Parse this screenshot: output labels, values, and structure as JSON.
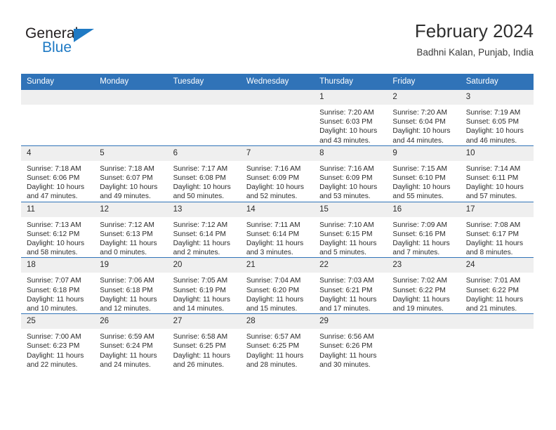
{
  "brand": {
    "name_part1": "General",
    "name_part2": "Blue",
    "accent_color": "#1f7ac4"
  },
  "header": {
    "title": "February 2024",
    "subtitle": "Badhni Kalan, Punjab, India"
  },
  "theme": {
    "header_bar_color": "#3073b8",
    "daynum_band_color": "#efefef",
    "text_color": "#2b2b2b"
  },
  "weekday_headers": [
    "Sunday",
    "Monday",
    "Tuesday",
    "Wednesday",
    "Thursday",
    "Friday",
    "Saturday"
  ],
  "weeks": [
    [
      {
        "day": "",
        "empty": true
      },
      {
        "day": "",
        "empty": true
      },
      {
        "day": "",
        "empty": true
      },
      {
        "day": "",
        "empty": true
      },
      {
        "day": "1",
        "sunrise": "Sunrise: 7:20 AM",
        "sunset": "Sunset: 6:03 PM",
        "daylight_line1": "Daylight: 10 hours",
        "daylight_line2": "and 43 minutes."
      },
      {
        "day": "2",
        "sunrise": "Sunrise: 7:20 AM",
        "sunset": "Sunset: 6:04 PM",
        "daylight_line1": "Daylight: 10 hours",
        "daylight_line2": "and 44 minutes."
      },
      {
        "day": "3",
        "sunrise": "Sunrise: 7:19 AM",
        "sunset": "Sunset: 6:05 PM",
        "daylight_line1": "Daylight: 10 hours",
        "daylight_line2": "and 46 minutes."
      }
    ],
    [
      {
        "day": "4",
        "sunrise": "Sunrise: 7:18 AM",
        "sunset": "Sunset: 6:06 PM",
        "daylight_line1": "Daylight: 10 hours",
        "daylight_line2": "and 47 minutes."
      },
      {
        "day": "5",
        "sunrise": "Sunrise: 7:18 AM",
        "sunset": "Sunset: 6:07 PM",
        "daylight_line1": "Daylight: 10 hours",
        "daylight_line2": "and 49 minutes."
      },
      {
        "day": "6",
        "sunrise": "Sunrise: 7:17 AM",
        "sunset": "Sunset: 6:08 PM",
        "daylight_line1": "Daylight: 10 hours",
        "daylight_line2": "and 50 minutes."
      },
      {
        "day": "7",
        "sunrise": "Sunrise: 7:16 AM",
        "sunset": "Sunset: 6:09 PM",
        "daylight_line1": "Daylight: 10 hours",
        "daylight_line2": "and 52 minutes."
      },
      {
        "day": "8",
        "sunrise": "Sunrise: 7:16 AM",
        "sunset": "Sunset: 6:09 PM",
        "daylight_line1": "Daylight: 10 hours",
        "daylight_line2": "and 53 minutes."
      },
      {
        "day": "9",
        "sunrise": "Sunrise: 7:15 AM",
        "sunset": "Sunset: 6:10 PM",
        "daylight_line1": "Daylight: 10 hours",
        "daylight_line2": "and 55 minutes."
      },
      {
        "day": "10",
        "sunrise": "Sunrise: 7:14 AM",
        "sunset": "Sunset: 6:11 PM",
        "daylight_line1": "Daylight: 10 hours",
        "daylight_line2": "and 57 minutes."
      }
    ],
    [
      {
        "day": "11",
        "sunrise": "Sunrise: 7:13 AM",
        "sunset": "Sunset: 6:12 PM",
        "daylight_line1": "Daylight: 10 hours",
        "daylight_line2": "and 58 minutes."
      },
      {
        "day": "12",
        "sunrise": "Sunrise: 7:12 AM",
        "sunset": "Sunset: 6:13 PM",
        "daylight_line1": "Daylight: 11 hours",
        "daylight_line2": "and 0 minutes."
      },
      {
        "day": "13",
        "sunrise": "Sunrise: 7:12 AM",
        "sunset": "Sunset: 6:14 PM",
        "daylight_line1": "Daylight: 11 hours",
        "daylight_line2": "and 2 minutes."
      },
      {
        "day": "14",
        "sunrise": "Sunrise: 7:11 AM",
        "sunset": "Sunset: 6:14 PM",
        "daylight_line1": "Daylight: 11 hours",
        "daylight_line2": "and 3 minutes."
      },
      {
        "day": "15",
        "sunrise": "Sunrise: 7:10 AM",
        "sunset": "Sunset: 6:15 PM",
        "daylight_line1": "Daylight: 11 hours",
        "daylight_line2": "and 5 minutes."
      },
      {
        "day": "16",
        "sunrise": "Sunrise: 7:09 AM",
        "sunset": "Sunset: 6:16 PM",
        "daylight_line1": "Daylight: 11 hours",
        "daylight_line2": "and 7 minutes."
      },
      {
        "day": "17",
        "sunrise": "Sunrise: 7:08 AM",
        "sunset": "Sunset: 6:17 PM",
        "daylight_line1": "Daylight: 11 hours",
        "daylight_line2": "and 8 minutes."
      }
    ],
    [
      {
        "day": "18",
        "sunrise": "Sunrise: 7:07 AM",
        "sunset": "Sunset: 6:18 PM",
        "daylight_line1": "Daylight: 11 hours",
        "daylight_line2": "and 10 minutes."
      },
      {
        "day": "19",
        "sunrise": "Sunrise: 7:06 AM",
        "sunset": "Sunset: 6:18 PM",
        "daylight_line1": "Daylight: 11 hours",
        "daylight_line2": "and 12 minutes."
      },
      {
        "day": "20",
        "sunrise": "Sunrise: 7:05 AM",
        "sunset": "Sunset: 6:19 PM",
        "daylight_line1": "Daylight: 11 hours",
        "daylight_line2": "and 14 minutes."
      },
      {
        "day": "21",
        "sunrise": "Sunrise: 7:04 AM",
        "sunset": "Sunset: 6:20 PM",
        "daylight_line1": "Daylight: 11 hours",
        "daylight_line2": "and 15 minutes."
      },
      {
        "day": "22",
        "sunrise": "Sunrise: 7:03 AM",
        "sunset": "Sunset: 6:21 PM",
        "daylight_line1": "Daylight: 11 hours",
        "daylight_line2": "and 17 minutes."
      },
      {
        "day": "23",
        "sunrise": "Sunrise: 7:02 AM",
        "sunset": "Sunset: 6:22 PM",
        "daylight_line1": "Daylight: 11 hours",
        "daylight_line2": "and 19 minutes."
      },
      {
        "day": "24",
        "sunrise": "Sunrise: 7:01 AM",
        "sunset": "Sunset: 6:22 PM",
        "daylight_line1": "Daylight: 11 hours",
        "daylight_line2": "and 21 minutes."
      }
    ],
    [
      {
        "day": "25",
        "sunrise": "Sunrise: 7:00 AM",
        "sunset": "Sunset: 6:23 PM",
        "daylight_line1": "Daylight: 11 hours",
        "daylight_line2": "and 22 minutes."
      },
      {
        "day": "26",
        "sunrise": "Sunrise: 6:59 AM",
        "sunset": "Sunset: 6:24 PM",
        "daylight_line1": "Daylight: 11 hours",
        "daylight_line2": "and 24 minutes."
      },
      {
        "day": "27",
        "sunrise": "Sunrise: 6:58 AM",
        "sunset": "Sunset: 6:25 PM",
        "daylight_line1": "Daylight: 11 hours",
        "daylight_line2": "and 26 minutes."
      },
      {
        "day": "28",
        "sunrise": "Sunrise: 6:57 AM",
        "sunset": "Sunset: 6:25 PM",
        "daylight_line1": "Daylight: 11 hours",
        "daylight_line2": "and 28 minutes."
      },
      {
        "day": "29",
        "sunrise": "Sunrise: 6:56 AM",
        "sunset": "Sunset: 6:26 PM",
        "daylight_line1": "Daylight: 11 hours",
        "daylight_line2": "and 30 minutes."
      },
      {
        "day": "",
        "empty": true
      },
      {
        "day": "",
        "empty": true
      }
    ]
  ]
}
